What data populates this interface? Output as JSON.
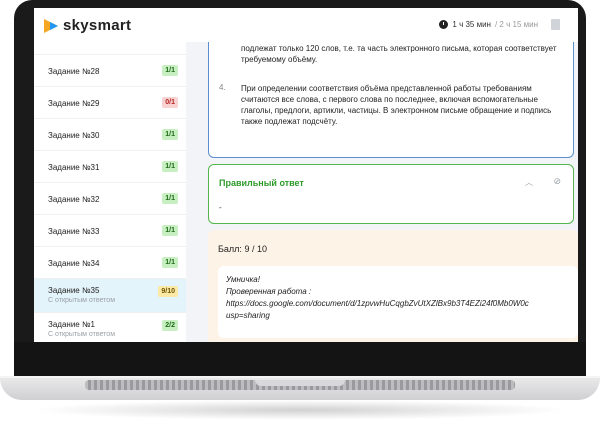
{
  "brand": {
    "name": "skysmart",
    "logo_colors": [
      "#f5a623",
      "#2196f3"
    ]
  },
  "timer": {
    "elapsed": "1 ч 35 мин",
    "total": "/ 2 ч 15 мин"
  },
  "sidebar": {
    "items": [
      {
        "label": "Задание №28",
        "badge": "1/1",
        "status": "green",
        "sub": ""
      },
      {
        "label": "Задание №29",
        "badge": "0/1",
        "status": "red",
        "sub": ""
      },
      {
        "label": "Задание №30",
        "badge": "1/1",
        "status": "green",
        "sub": ""
      },
      {
        "label": "Задание №31",
        "badge": "1/1",
        "status": "green",
        "sub": ""
      },
      {
        "label": "Задание №32",
        "badge": "1/1",
        "status": "green",
        "sub": ""
      },
      {
        "label": "Задание №33",
        "badge": "1/1",
        "status": "green",
        "sub": ""
      },
      {
        "label": "Задание №34",
        "badge": "1/1",
        "status": "green",
        "sub": ""
      },
      {
        "label": "Задание №35",
        "badge": "9/10",
        "status": "yellow",
        "sub": "С открытым ответом",
        "active": true
      },
      {
        "label": "Задание №1",
        "badge": "2/2",
        "status": "green",
        "sub": "С открытым ответом"
      }
    ]
  },
  "task_text": {
    "line_top": "подлежат только 120 слов, т.е. та часть электронного письма, которая соответствует требуемому объёму.",
    "item_number": "4.",
    "item_text": "При определении соответствия объёма представленной работы требованиям считаются все слова, с первого слова по последнее, включая вспомогательные глаголы, предлоги, артикли, частицы. В электронном письме обращение и подпись также подлежат подсчёту."
  },
  "correct_answer": {
    "title": "Правильный ответ",
    "value": "-"
  },
  "score": {
    "label": "Балл:",
    "value": "9 / 10"
  },
  "comment": {
    "line1": "Умничка!",
    "line2": "Проверенная работа :",
    "line3": "https://docs.google.com/document/d/1zpvwHuCqgbZvUtXZlBx9b3T4EZi24f0Mb0W0c",
    "line4": "usp=sharing"
  },
  "colors": {
    "green": "#2e9b2b",
    "blue_border": "#5b8ed1",
    "score_bg": "#fdf3e7"
  }
}
